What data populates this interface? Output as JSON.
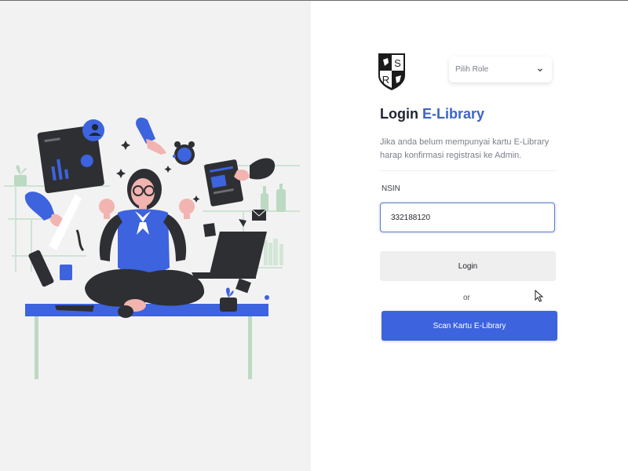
{
  "logo": {
    "letters": [
      "S",
      "R"
    ]
  },
  "role_select": {
    "selected": "Pilih Role"
  },
  "login": {
    "title_prefix": "Login",
    "title_accent": "E-Library",
    "subtitle": "Jika anda belum mempunyai kartu E-Library harap konfirmasi registrasi ke Admin.",
    "nsin_label": "NSIN",
    "nsin_value": "332188120",
    "login_button": "Login",
    "or_text": "or",
    "scan_button": "Scan Kartu E-Library"
  },
  "colors": {
    "accent": "#3d63de",
    "title_accent": "#3d63c9",
    "left_background": "#f2f2f3"
  },
  "icons": [
    "shield-logo-icon",
    "chevron-down-icon",
    "mouse-cursor-icon"
  ]
}
